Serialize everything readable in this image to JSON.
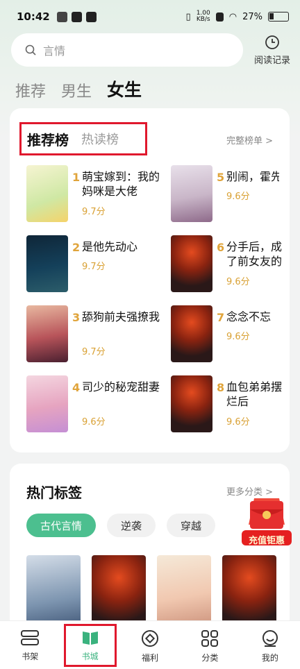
{
  "status": {
    "time": "10:42",
    "speed_top": "1.00",
    "speed_bottom": "KB/s",
    "battery": "27%"
  },
  "search": {
    "placeholder": "言情"
  },
  "history": {
    "label": "阅读记录"
  },
  "tabs": [
    {
      "label": "推荐"
    },
    {
      "label": "男生"
    },
    {
      "label": "女生"
    }
  ],
  "ranking": {
    "tab_active": "推荐榜",
    "tab_other": "热读榜",
    "more": "完整榜单 >",
    "books": [
      {
        "num": "1",
        "title": "萌宝嫁到：我的妈咪是大佬",
        "score": "9.7分"
      },
      {
        "num": "2",
        "title": "是他先动心",
        "score": "9.7分"
      },
      {
        "num": "3",
        "title": "舔狗前夫强撩我",
        "score": "9.7分"
      },
      {
        "num": "4",
        "title": "司少的秘宠甜妻",
        "score": "9.6分"
      },
      {
        "num": "5",
        "title": "别闹，霍先生",
        "score": "9.6分"
      },
      {
        "num": "6",
        "title": "分手后，成了前女友的朱砂痣",
        "score": "9.6分"
      },
      {
        "num": "7",
        "title": "念念不忘",
        "score": "9.6分"
      },
      {
        "num": "8",
        "title": "血包弟弟摆烂后",
        "score": "9.6分"
      }
    ]
  },
  "hot": {
    "title": "热门标签",
    "more": "更多分类 >",
    "chips": [
      {
        "label": "古代言情"
      },
      {
        "label": "逆袭"
      },
      {
        "label": "穿越"
      }
    ]
  },
  "redpack": {
    "label": "充值钜惠"
  },
  "nav": [
    {
      "label": "书架"
    },
    {
      "label": "书城"
    },
    {
      "label": "福利"
    },
    {
      "label": "分类"
    },
    {
      "label": "我的"
    }
  ],
  "colors": {
    "accent": "#3ab27e",
    "highlight": "#e0182d",
    "score": "#d9a134"
  }
}
